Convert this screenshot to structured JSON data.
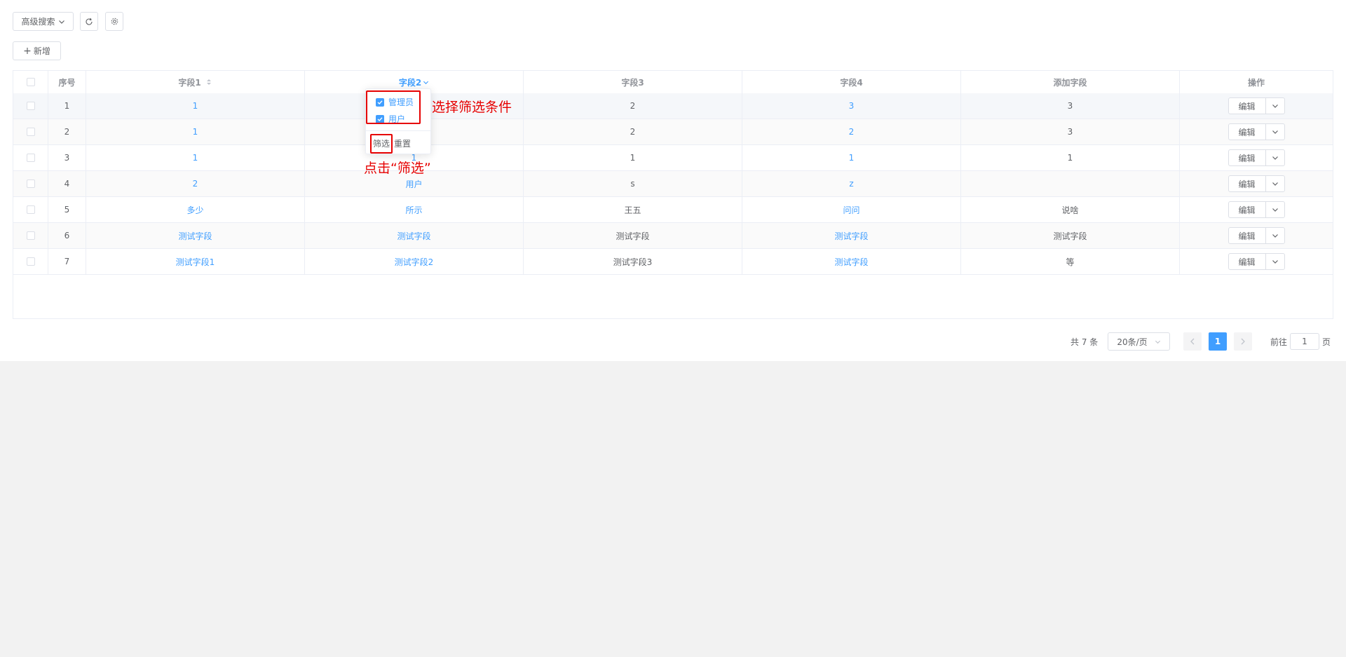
{
  "toolbar": {
    "advanced_search": "高级搜索",
    "add": "新增"
  },
  "table": {
    "headers": {
      "index": "序号",
      "field1": "字段1",
      "field2": "字段2",
      "field3": "字段3",
      "field4": "字段4",
      "added": "添加字段",
      "ops": "操作"
    },
    "rows": [
      {
        "index": "1",
        "f1": "1",
        "f2": "",
        "f3": "2",
        "f4": "3",
        "add": "3"
      },
      {
        "index": "2",
        "f1": "1",
        "f2": "",
        "f3": "2",
        "f4": "2",
        "add": "3"
      },
      {
        "index": "3",
        "f1": "1",
        "f2": "1",
        "f3": "1",
        "f4": "1",
        "add": "1"
      },
      {
        "index": "4",
        "f1": "2",
        "f2": "用户",
        "f3": "s",
        "f4": "z",
        "add": ""
      },
      {
        "index": "5",
        "f1": "多少",
        "f2": "所示",
        "f3": "王五",
        "f4": "问问",
        "add": "说啥"
      },
      {
        "index": "6",
        "f1": "测试字段",
        "f2": "测试字段",
        "f3": "测试字段",
        "f4": "测试字段",
        "add": "测试字段"
      },
      {
        "index": "7",
        "f1": "测试字段1",
        "f2": "测试字段2",
        "f3": "测试字段3",
        "f4": "测试字段",
        "add": "等"
      }
    ],
    "edit_label": "编辑"
  },
  "filter": {
    "options": [
      "管理员",
      "用户"
    ],
    "confirm": "筛选",
    "reset": "重置"
  },
  "annotations": {
    "select": "选择筛选条件",
    "click": "点击“筛选”"
  },
  "pagination": {
    "total": "共 7 条",
    "page_size": "20条/页",
    "current": "1",
    "goto_prefix": "前往",
    "goto_value": "1",
    "goto_suffix": "页"
  },
  "colors": {
    "primary": "#409eff",
    "annotation": "#e60000"
  }
}
